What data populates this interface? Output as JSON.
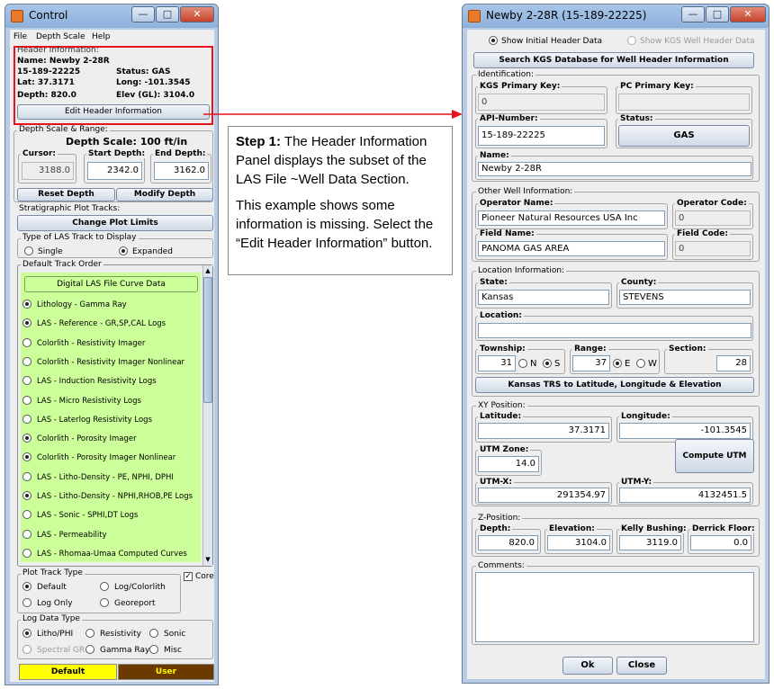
{
  "control": {
    "title": "Control",
    "menu": [
      "File",
      "Depth Scale",
      "Help"
    ],
    "header_group": "Header Information:",
    "name_line": "Name: Newby 2-28R",
    "api_line": "15-189-22225",
    "status_line": "Status: GAS",
    "lat_line": "Lat: 37.3171",
    "long_line": "Long: -101.3545",
    "depth_line": "Depth: 820.0",
    "elev_line": "Elev (GL): 3104.0",
    "edit_header_button": "Edit Header Information",
    "depth_group": "Depth Scale & Range:",
    "depth_scale": "Depth Scale: 100 ft/in",
    "cursor_label": "Cursor:",
    "cursor_value": "3188.0",
    "start_label": "Start Depth:",
    "start_value": "2342.0",
    "end_label": "End Depth:",
    "end_value": "3162.0",
    "reset_depth": "Reset Depth",
    "modify_depth": "Modify Depth",
    "strat_group": "Stratigraphic Plot Tracks:",
    "change_limits": "Change Plot Limits",
    "las_track_group": "Type of LAS Track to Display",
    "single": "Single",
    "expanded": "Expanded",
    "default_track_group": "Default Track Order",
    "digital_button": "Digital LAS File Curve Data",
    "tracks": [
      {
        "label": "Lithology - Gamma Ray",
        "selected": true
      },
      {
        "label": "LAS - Reference - GR,SP,CAL Logs",
        "selected": true
      },
      {
        "label": "Colorlith - Resistivity Imager",
        "selected": false
      },
      {
        "label": "Colorlith - Resistivity Imager Nonlinear",
        "selected": false
      },
      {
        "label": "LAS - Induction Resistivity Logs",
        "selected": false
      },
      {
        "label": "LAS - Micro Resistivity Logs",
        "selected": false
      },
      {
        "label": "LAS - Laterlog Resistivity Logs",
        "selected": false
      },
      {
        "label": "Colorlith - Porosity Imager",
        "selected": true
      },
      {
        "label": "Colorlith - Porosity Imager Nonlinear",
        "selected": true
      },
      {
        "label": "LAS - Litho-Density - PE, NPHI, DPHI",
        "selected": false
      },
      {
        "label": "LAS - Litho-Density - NPHI,RHOB,PE Logs",
        "selected": true
      },
      {
        "label": "LAS - Sonic - SPHI,DT Logs",
        "selected": false
      },
      {
        "label": "LAS - Permeability",
        "selected": false
      },
      {
        "label": "LAS - Rhomaa-Umaa Computed Curves",
        "selected": false
      }
    ],
    "plot_track_group": "Plot Track Type",
    "core": "Core",
    "pt_default": "Default",
    "pt_logcolorlith": "Log/Colorlith",
    "pt_logonly": "Log Only",
    "pt_georeport": "Georeport",
    "log_data_group": "Log Data Type",
    "ld_litho": "Litho/PHI",
    "ld_resistivity": "Resistivity",
    "ld_sonic": "Sonic",
    "ld_spectral": "Spectral GR",
    "ld_gamma": "Gamma Ray",
    "ld_misc": "Misc",
    "bottom_default": "Default",
    "bottom_user": "User"
  },
  "note": {
    "step_bold": "Step 1:",
    "step_text": " The Header Information Panel displays the subset of the LAS File ~Well Data Section.",
    "para2": "This example shows some information is missing.  Select the “Edit Header Information” button."
  },
  "editor": {
    "title": "Newby 2-28R (15-189-22225)",
    "show_initial": "Show Initial Header Data",
    "show_kgs": "Show KGS Well Header Data",
    "search_button": "Search KGS Database for Well Header Information",
    "identification": "Identification:",
    "kgs_key_label": "KGS Primary Key:",
    "kgs_key_value": "0",
    "pc_key_label": "PC Primary Key:",
    "pc_key_value": "",
    "api_label": "API-Number:",
    "api_value": "15-189-22225",
    "status_label": "Status:",
    "status_value": "GAS",
    "name_label": "Name:",
    "name_value": "Newby 2-28R",
    "other_group": "Other Well Information:",
    "operator_label": "Operator Name:",
    "operator_value": "Pioneer Natural Resources USA Inc",
    "opcode_label": "Operator Code:",
    "opcode_value": "0",
    "field_label": "Field Name:",
    "field_value": "PANOMA GAS AREA",
    "fieldcode_label": "Field Code:",
    "fieldcode_value": "0",
    "location_group": "Location Information:",
    "state_label": "State:",
    "state_value": "Kansas",
    "county_label": "County:",
    "county_value": "STEVENS",
    "location_label": "Location:",
    "location_value": "",
    "township_label": "Township:",
    "township_value": "31",
    "n": "N",
    "s": "S",
    "range_label": "Range:",
    "range_value": "37",
    "e": "E",
    "w": "W",
    "section_label": "Section:",
    "section_value": "28",
    "trs_button": "Kansas TRS to Latitude, Longitude & Elevation",
    "xy_group": "XY Position:",
    "lat_label": "Latitude:",
    "lat_value": "37.3171",
    "long_label": "Longitude:",
    "long_value": "-101.3545",
    "utm_zone_label": "UTM Zone:",
    "utm_zone_value": "14.0",
    "compute_utm": "Compute UTM",
    "utmx_label": "UTM-X:",
    "utmx_value": "291354.97",
    "utmy_label": "UTM-Y:",
    "utmy_value": "4132451.5",
    "z_group": "Z-Position:",
    "depth_label": "Depth:",
    "depth_value": "820.0",
    "elev_label": "Elevation:",
    "elev_value": "3104.0",
    "kb_label": "Kelly Bushing:",
    "kb_value": "3119.0",
    "df_label": "Derrick Floor:",
    "df_value": "0.0",
    "comments_group": "Comments:",
    "ok": "Ok",
    "close": "Close"
  },
  "colors": {
    "highlight_red": "#e8121a",
    "track_green": "#ccff99",
    "default_yellow": "#ffff00",
    "user_brown": "#6b3a00"
  }
}
